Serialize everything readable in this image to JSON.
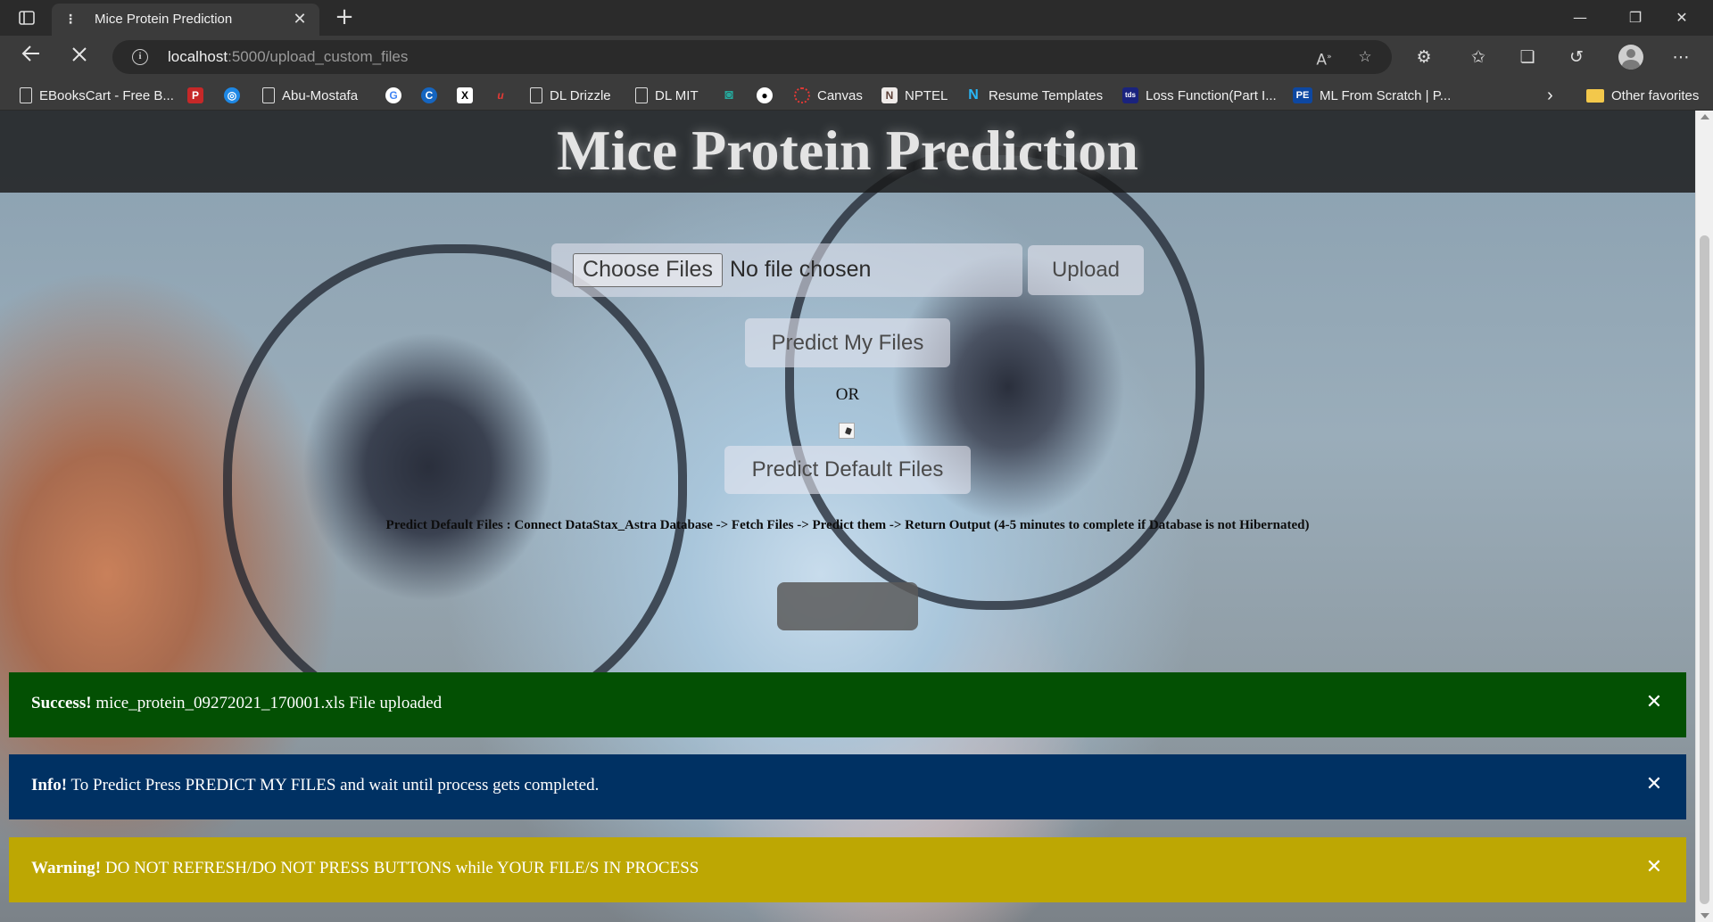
{
  "browser": {
    "tab": {
      "title": "Mice Protein Prediction",
      "close": "✕"
    },
    "new_tab": "+",
    "window": {
      "minimize": "—",
      "restore": "❐",
      "close": "✕"
    },
    "address": {
      "host": "localhost",
      "path": ":5000/upload_custom_files"
    },
    "bookmarks": [
      {
        "label": "EBooksCart - Free B...",
        "icon": "page-icon"
      },
      {
        "label": "",
        "icon": "pdf-icon",
        "color": "#c62828"
      },
      {
        "label": "",
        "icon": "globe-blue-icon",
        "color": "#1e88e5"
      },
      {
        "label": "Abu-Mostafa",
        "icon": "page-icon"
      },
      {
        "label": "",
        "icon": "google-icon",
        "color": "#ffffff"
      },
      {
        "label": "",
        "icon": "c-icon",
        "color": "#1565c0"
      },
      {
        "label": "",
        "icon": "x-icon",
        "color": "#000000"
      },
      {
        "label": "",
        "icon": "u-icon",
        "color": "#d32f2f"
      },
      {
        "label": "DL Drizzle",
        "icon": "page-icon"
      },
      {
        "label": "DL MIT",
        "icon": "page-icon"
      },
      {
        "label": "",
        "icon": "spiral-icon",
        "color": "#26a69a"
      },
      {
        "label": "",
        "icon": "github-icon",
        "color": "#ffffff"
      },
      {
        "label": "Canvas",
        "icon": "canvas-icon",
        "color": "#e53935"
      },
      {
        "label": "NPTEL",
        "icon": "nptel-icon",
        "color": "#8d6e63"
      },
      {
        "label": "Resume Templates",
        "icon": "n-logo-icon",
        "color": "#29b6f6"
      },
      {
        "label": "Loss Function(Part I...",
        "icon": "tds-icon",
        "color": "#1a237e"
      },
      {
        "label": "ML From Scratch | P...",
        "icon": "pe-icon",
        "color": "#0d47a1"
      }
    ],
    "other_favorites": "Other favorites"
  },
  "page": {
    "title": "Mice Protein Prediction",
    "choose_files": "Choose Files",
    "no_file": "No file chosen",
    "upload": "Upload",
    "predict_my_files": "Predict My Files",
    "or": "OR",
    "predict_default_files": "Predict Default Files",
    "description": "Predict Default Files : Connect DataStax_Astra Database -> Fetch Files -> Predict them -> Return Output (4-5 minutes to complete if Database is not Hibernated)"
  },
  "alerts": {
    "success": {
      "label": "Success!",
      "text": " mice_protein_09272021_170001.xls File uploaded",
      "color": "#035003"
    },
    "info": {
      "label": "Info!",
      "text": " To Predict Press PREDICT MY FILES and wait until process gets completed.",
      "color": "#003163"
    },
    "warning": {
      "label": "Warning!",
      "text": " DO NOT REFRESH/DO NOT PRESS BUTTONS while YOUR FILE/S IN PROCESS",
      "color": "#bda703"
    },
    "close_glyph": "✕"
  }
}
